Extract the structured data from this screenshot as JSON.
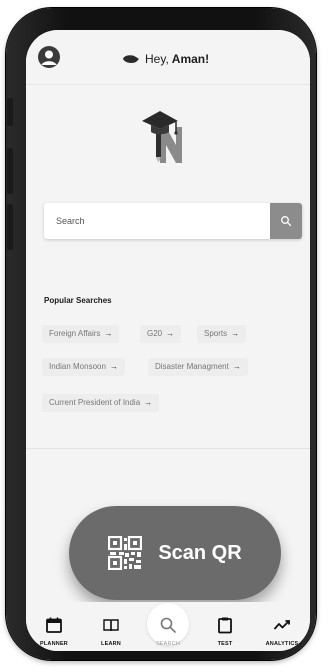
{
  "header": {
    "greeting_prefix": "Hey,",
    "user_name": "Aman!"
  },
  "search": {
    "placeholder": "Search"
  },
  "popular": {
    "title": "Popular Searches",
    "chips": [
      {
        "label": "Foreign Affairs",
        "arrow": "→"
      },
      {
        "label": "G20",
        "arrow": "→"
      },
      {
        "label": "Sports",
        "arrow": "→"
      },
      {
        "label": "Indian Monsoon",
        "arrow": "→"
      },
      {
        "label": "Disaster Managment",
        "arrow": "→"
      },
      {
        "label": "Current President of India",
        "arrow": "→"
      }
    ]
  },
  "scan": {
    "label": "Scan QR"
  },
  "nav": {
    "items": [
      {
        "label": "PLANNER",
        "icon": "calendar-icon"
      },
      {
        "label": "LEARN",
        "icon": "book-icon"
      },
      {
        "label": "SEARCH",
        "icon": "search-icon"
      },
      {
        "label": "TEST",
        "icon": "clipboard-icon"
      },
      {
        "label": "ANALYTICS",
        "icon": "trend-icon"
      }
    ],
    "active": "SEARCH"
  },
  "colors": {
    "screen_bg": "#f4f4f4",
    "search_button": "#8c8c8c",
    "scan_button": "#6b6b6b",
    "chip_bg": "#ededed"
  }
}
